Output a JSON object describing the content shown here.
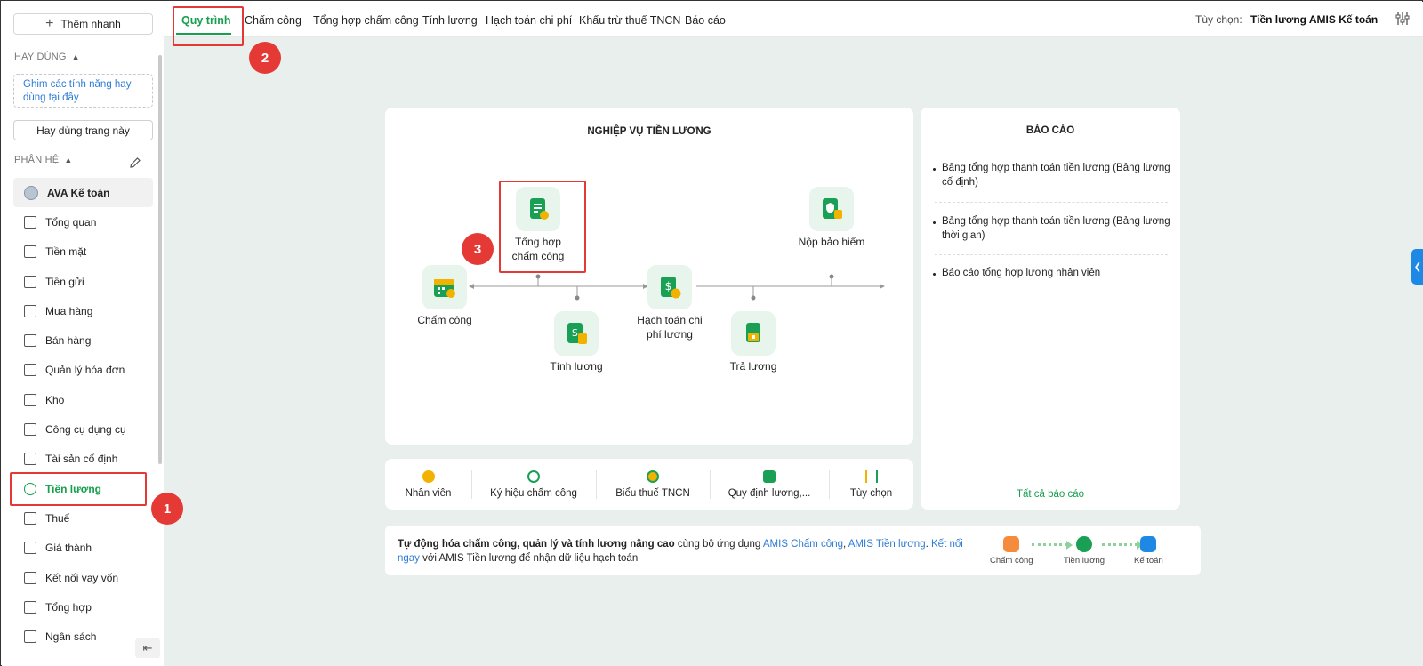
{
  "sidebar": {
    "quick_add": "Thêm nhanh",
    "frequent_title": "HAY DÙNG",
    "pin_hint": "Ghim các tính năng hay dùng tại đây",
    "use_page": "Hay dùng trang này",
    "modules_title": "PHÂN HỆ",
    "items": [
      {
        "label": "AVA Kế toán",
        "icon": "avatar-icon"
      },
      {
        "label": "Tổng quan",
        "icon": "dashboard-icon"
      },
      {
        "label": "Tiền mặt",
        "icon": "cash-icon"
      },
      {
        "label": "Tiền gửi",
        "icon": "bank-icon"
      },
      {
        "label": "Mua hàng",
        "icon": "shopping-bag-icon"
      },
      {
        "label": "Bán hàng",
        "icon": "cart-icon"
      },
      {
        "label": "Quản lý hóa đơn",
        "icon": "invoice-icon"
      },
      {
        "label": "Kho",
        "icon": "warehouse-icon"
      },
      {
        "label": "Công cụ dụng cụ",
        "icon": "tools-icon"
      },
      {
        "label": "Tài sản cố định",
        "icon": "truck-icon"
      },
      {
        "label": "Tiền lương",
        "icon": "salary-icon"
      },
      {
        "label": "Thuế",
        "icon": "tax-icon"
      },
      {
        "label": "Giá thành",
        "icon": "tag-icon"
      },
      {
        "label": "Kết nối vay vốn",
        "icon": "loan-icon"
      },
      {
        "label": "Tổng hợp",
        "icon": "summary-icon"
      },
      {
        "label": "Ngân sách",
        "icon": "budget-icon"
      }
    ],
    "active_index": 10
  },
  "topbar": {
    "tabs": [
      "Quy trình",
      "Chấm công",
      "Tổng hợp chấm công",
      "Tính lương",
      "Hạch toán chi phí",
      "Khấu trừ thuế TNCN",
      "Báo cáo"
    ],
    "active_tab": 0,
    "option_label": "Tùy chọn:",
    "option_value": "Tiền lương AMIS Kế toán"
  },
  "workflow": {
    "title": "NGHIỆP VỤ TIỀN LƯƠNG",
    "nodes": {
      "timesheet": "Chấm công",
      "timesheet_summary_1": "Tổng hợp",
      "timesheet_summary_2": "chấm công",
      "payroll": "Tính lương",
      "accounting_1": "Hạch toán chi",
      "accounting_2": "phí lương",
      "payment": "Trả lương",
      "insurance": "Nộp bảo hiểm"
    }
  },
  "reports": {
    "title": "BÁO CÁO",
    "items": [
      "Bảng tổng hợp thanh toán tiền lương (Bảng lương cố định)",
      "Bảng tổng hợp thanh toán tiền lương (Bảng lương thời gian)",
      "Báo cáo tổng hợp lương nhân viên"
    ],
    "all_link": "Tất cả báo cáo"
  },
  "toolbar": [
    "Nhân viên",
    "Ký hiệu chấm công",
    "Biểu thuế TNCN",
    "Quy định lương,...",
    "Tùy chọn"
  ],
  "promo": {
    "bold": "Tự động hóa chấm công, quản lý và tính lương nâng cao",
    "text1": " cùng bộ ứng dụng ",
    "link1": "AMIS Chấm công",
    "comma": ", ",
    "link2": "AMIS Tiền lương",
    "dot": ". ",
    "link3": "Kết nối ngay",
    "text2": " với AMIS Tiền lương để nhận dữ liệu hạch toán",
    "steps": [
      "Chấm công",
      "Tiền lương",
      "Kế toán"
    ]
  },
  "annotations": [
    "1",
    "2",
    "3"
  ],
  "colors": {
    "accent": "#15a04d",
    "annotation": "#e53935",
    "link": "#2e7cd6",
    "background": "#e9efec"
  }
}
